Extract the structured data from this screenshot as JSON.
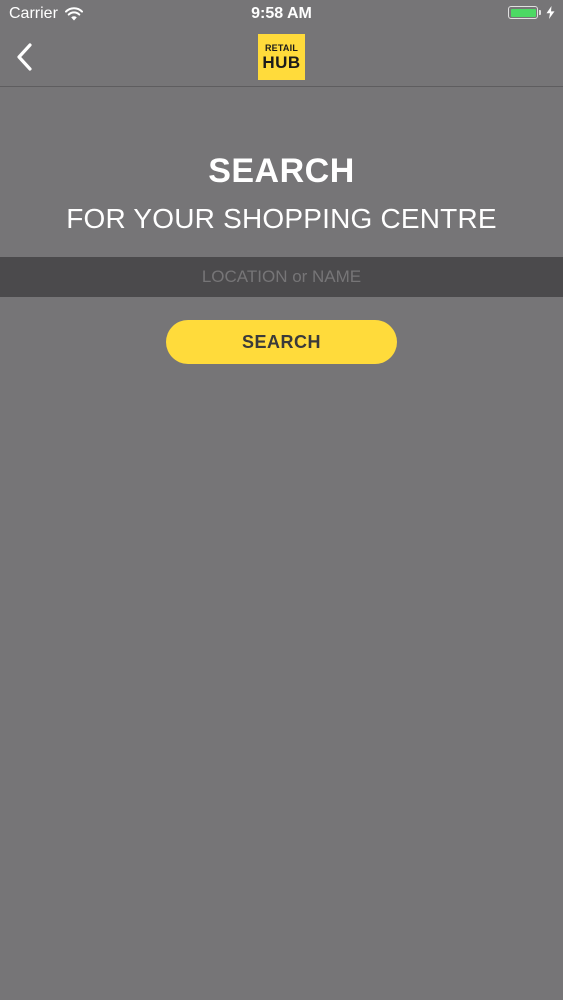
{
  "status_bar": {
    "carrier": "Carrier",
    "time": "9:58 AM",
    "wifi_icon": "wifi-icon",
    "battery_icon": "battery-icon",
    "charging_icon": "bolt-icon",
    "battery_color": "#4cd964"
  },
  "nav": {
    "back_icon": "chevron-left-icon",
    "logo": {
      "top": "RETAIL",
      "bottom": "HUB",
      "color": "#ffdb3b"
    }
  },
  "main": {
    "title": "SEARCH",
    "subtitle": "FOR YOUR SHOPPING CENTRE",
    "search_placeholder": "LOCATION or NAME",
    "search_value": "",
    "search_button_label": "SEARCH",
    "accent_color": "#ffdb3b",
    "background_color": "#767577"
  }
}
